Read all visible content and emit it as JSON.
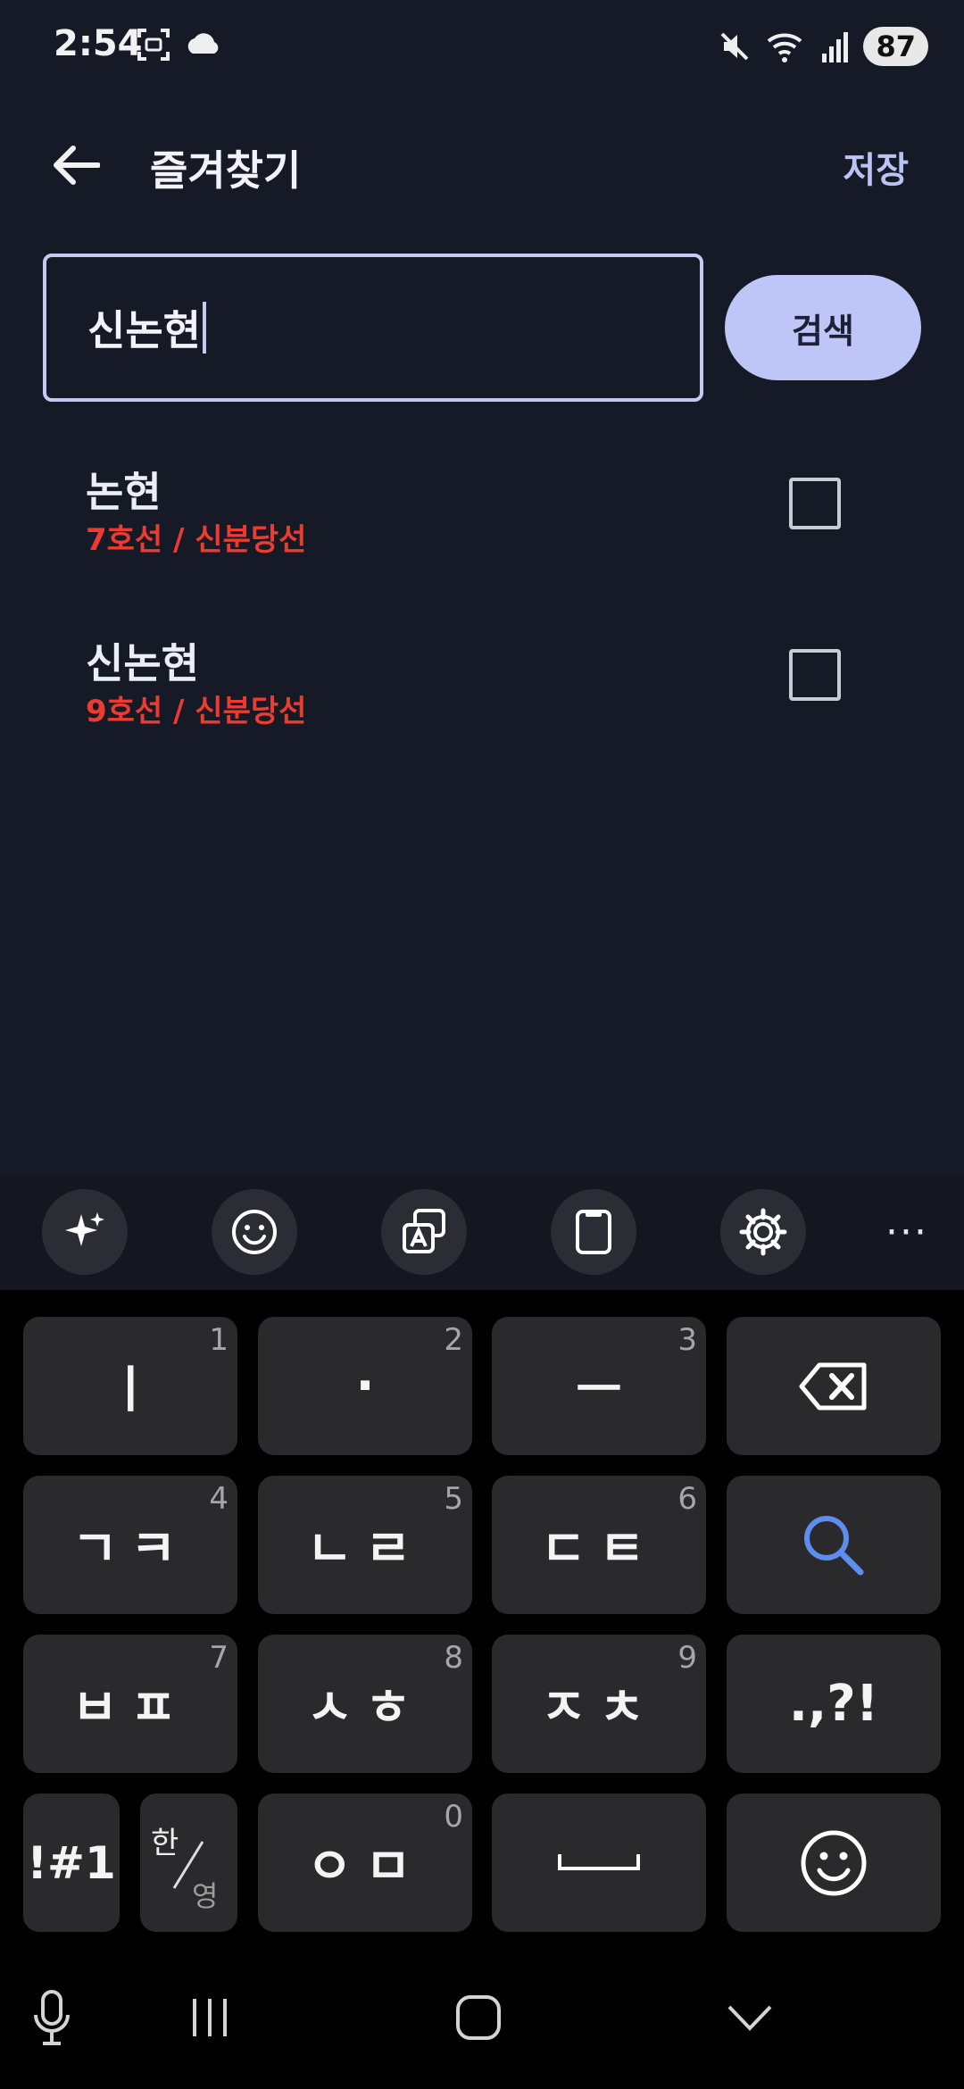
{
  "status": {
    "time": "2:54",
    "battery": "87",
    "icons": [
      "screenshot-icon",
      "weather-icon",
      "mute-icon",
      "wifi-icon",
      "signal-icon",
      "battery-icon"
    ]
  },
  "appbar": {
    "title": "즐겨찾기",
    "save_label": "저장"
  },
  "search": {
    "value": "신논현",
    "button_label": "검색"
  },
  "results": [
    {
      "name": "논현",
      "lines": "7호선 / 신분당선",
      "checked": false
    },
    {
      "name": "신논현",
      "lines": "9호선 / 신분당선",
      "checked": false
    }
  ],
  "colors": {
    "background": "#161a26",
    "accent": "#bdc6f6",
    "line_text": "#ee3b31"
  },
  "keyboard": {
    "toolbar": [
      "ai-sparkle-icon",
      "emoji-icon",
      "translate-icon",
      "clipboard-icon",
      "settings-icon",
      "more-icon"
    ],
    "more_label": "···",
    "rows": [
      [
        {
          "label": "ㅣ",
          "num": "1"
        },
        {
          "label": "·",
          "num": "2"
        },
        {
          "label": "ㅡ",
          "num": "3"
        },
        {
          "label": "backspace"
        }
      ],
      [
        {
          "label": "ㄱㅋ",
          "num": "4"
        },
        {
          "label": "ㄴㄹ",
          "num": "5"
        },
        {
          "label": "ㄷㅌ",
          "num": "6"
        },
        {
          "label": "search"
        }
      ],
      [
        {
          "label": "ㅂㅍ",
          "num": "7"
        },
        {
          "label": "ㅅㅎ",
          "num": "8"
        },
        {
          "label": "ㅈㅊ",
          "num": "9"
        },
        {
          "label": ".,?!"
        }
      ],
      [
        {
          "label": "!#1"
        },
        {
          "label_top": "한",
          "label_bottom": "영"
        },
        {
          "label": "ㅇㅁ",
          "num": "0"
        },
        {
          "label": "space"
        },
        {
          "label": "emoji"
        }
      ]
    ]
  },
  "nav": [
    "mic-icon",
    "recent-apps-icon",
    "home-icon",
    "hide-keyboard-icon"
  ]
}
